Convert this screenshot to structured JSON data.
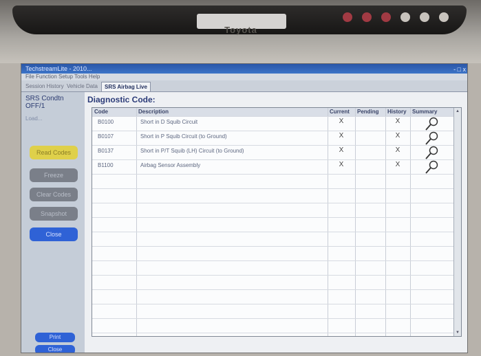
{
  "window": {
    "title": "TechstreamLite - 2010...",
    "menu": "File  Function  Setup  Tools  Help",
    "controls": "- □ x"
  },
  "tabs": [
    {
      "label": "Session History"
    },
    {
      "label": "Vehicle Data"
    },
    {
      "label": "SRS Airbag Live"
    }
  ],
  "left_panel": {
    "ecu_name": "SRS Condtn",
    "ecu_code": "OFF/1",
    "status_text": "Load...",
    "buttons": [
      {
        "label": "Read Codes",
        "color": "#dfd04a"
      },
      {
        "label": "Freeze",
        "color": "#7a7f89"
      },
      {
        "label": "Clear Codes",
        "color": "#7a7f89"
      },
      {
        "label": "Snapshot",
        "color": "#7a7f89"
      },
      {
        "label": "Close",
        "color": "#2f62d6"
      }
    ],
    "bottom_buttons": [
      {
        "label": "Print",
        "color": "#2f62d6"
      },
      {
        "label": "Close",
        "color": "#2f62d6"
      }
    ]
  },
  "main": {
    "heading": "Diagnostic Code:",
    "columns": [
      "Code",
      "Description",
      "Current",
      "Pending",
      "History",
      "Summary"
    ],
    "rows": [
      {
        "code": "B0100",
        "description": "Short in D Squib Circuit",
        "current": "X",
        "pending": "",
        "history": "X"
      },
      {
        "code": "B0107",
        "description": "Short in P Squib Circuit (to Ground)",
        "current": "X",
        "pending": "",
        "history": "X"
      },
      {
        "code": "B0137",
        "description": "Short in P/T Squib (LH) Circuit (to Ground)",
        "current": "X",
        "pending": "",
        "history": "X"
      },
      {
        "code": "B1100",
        "description": "Airbag Sensor Assembly",
        "current": "X",
        "pending": "",
        "history": "X"
      }
    ],
    "summary_icon": "magnifier-icon"
  },
  "device": {
    "brand": "Toyota",
    "accent": "#2f62d6"
  }
}
